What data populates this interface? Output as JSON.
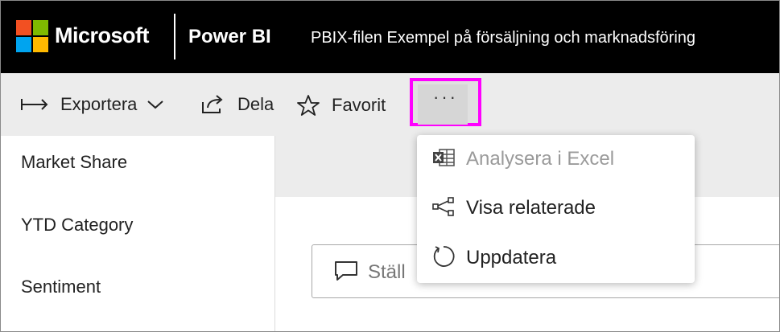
{
  "header": {
    "brand": "Microsoft",
    "product": "Power BI",
    "file_title": "PBIX-filen Exempel på försäljning och marknadsföring",
    "logo_colors": [
      "#f25022",
      "#7fba00",
      "#00a4ef",
      "#ffb900"
    ]
  },
  "toolbar": {
    "export_label": "Exportera",
    "share_label": "Dela",
    "favorite_label": "Favorit",
    "more_label": "···",
    "highlight_color": "#ff00ff"
  },
  "sidebar": {
    "items": [
      {
        "label": "Market Share"
      },
      {
        "label": "YTD Category"
      },
      {
        "label": "Sentiment"
      }
    ]
  },
  "qna": {
    "placeholder_visible": "Ställ"
  },
  "more_menu": {
    "items": [
      {
        "label": "Analysera i Excel",
        "icon": "excel-icon",
        "disabled": true
      },
      {
        "label": "Visa relaterade",
        "icon": "lineage-icon",
        "disabled": false
      },
      {
        "label": "Uppdatera",
        "icon": "refresh-icon",
        "disabled": false
      }
    ]
  }
}
